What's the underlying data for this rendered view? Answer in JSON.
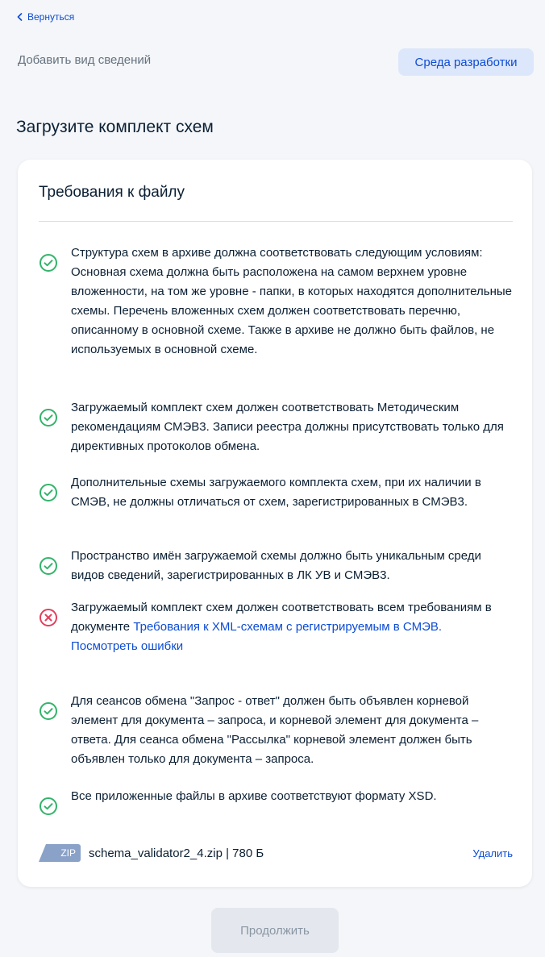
{
  "nav": {
    "back_label": "Вернуться",
    "back_icon": "chevron-left-icon"
  },
  "header": {
    "subtitle": "Добавить вид сведений",
    "environment_badge": "Среда разработки"
  },
  "page": {
    "title": "Загрузите комплект схем"
  },
  "card": {
    "title": "Требования к файлу",
    "requirements": [
      {
        "status": "ok",
        "icon": "check-circle-icon",
        "text": "Структура схем в архиве должна соответствовать следующим условиям: Основная схема должна быть расположена на самом верхнем уровне вложенности, на том же уровне - папки, в которых находятся дополнительные схемы. Перечень вложенных схем должен соответствовать перечню, описанному в основной схеме. Также в архиве не должно быть файлов, не используемых в основной схеме."
      },
      {
        "status": "ok",
        "icon": "check-circle-icon",
        "text": "Загружаемый комплект схем должен соответствовать Методическим рекомендациям СМЭВ3. Записи реестра должны присутствовать только для директивных протоколов обмена."
      },
      {
        "status": "ok",
        "icon": "check-circle-icon",
        "text": "Дополнительные схемы загружаемого комплекта схем, при их наличии в СМЭВ, не должны отличаться от схем, зарегистрированных в СМЭВ3."
      },
      {
        "status": "ok",
        "icon": "check-circle-icon",
        "text": "Пространство имён загружаемой схемы должно быть уникальным среди видов сведений, зарегистрированных в ЛК УВ и СМЭВ3."
      },
      {
        "status": "error",
        "icon": "error-circle-icon",
        "text": "Загружаемый комплект схем должен соответствовать всем требованиям в документе ",
        "link_text": "Требования к XML-схемам с регистрируемым в СМЭВ.",
        "errors_link": "Посмотреть ошибки"
      },
      {
        "status": "ok",
        "icon": "check-circle-icon",
        "text": "Для сеансов обмена \"Запрос - ответ\" должен быть объявлен корневой элемент для документа – запроса, и корневой элемент для документа – ответа. Для сеанса обмена \"Рассылка\" корневой элемент должен быть объявлен только для документа – запроса."
      },
      {
        "status": "ok",
        "icon": "check-circle-icon",
        "text": "Все приложенные файлы в архиве соответствуют формату XSD."
      }
    ],
    "file": {
      "type_badge": "ZIP",
      "name": "schema_validator2_4.zip | 780 Б",
      "delete_label": "Удалить"
    }
  },
  "footer": {
    "continue_label": "Продолжить"
  },
  "colors": {
    "background": "#f4f6f9",
    "accent": "#0d4cd3",
    "success": "#34b36b",
    "error": "#e33e5c",
    "text": "#0b1f33",
    "muted": "#66727f",
    "badge_bg": "#dde7fb",
    "zip_badge": "#8aa1c8",
    "button_disabled_bg": "#e4e8ee"
  }
}
